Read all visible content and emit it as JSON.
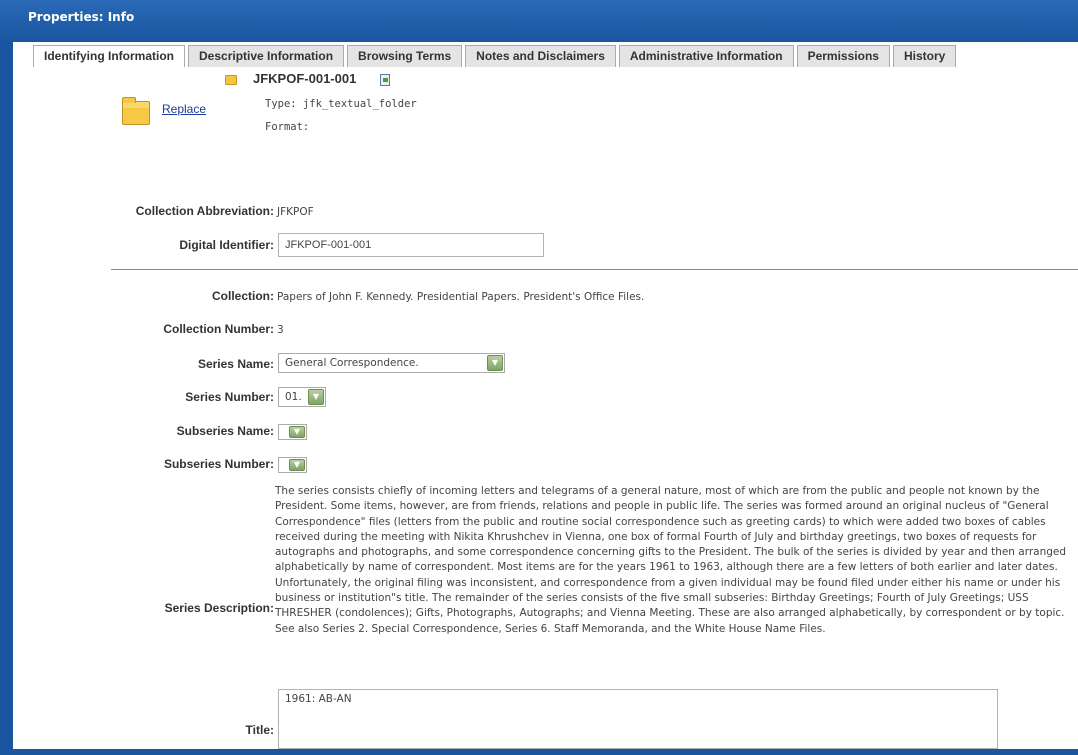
{
  "window": {
    "title": "Properties: Info"
  },
  "tabs": [
    {
      "label": "Identifying Information",
      "active": true
    },
    {
      "label": "Descriptive Information",
      "active": false
    },
    {
      "label": "Browsing Terms",
      "active": false
    },
    {
      "label": "Notes and Disclaimers",
      "active": false
    },
    {
      "label": "Administrative Information",
      "active": false
    },
    {
      "label": "Permissions",
      "active": false
    },
    {
      "label": "History",
      "active": false
    }
  ],
  "object": {
    "name": "JFKPOF-001-001",
    "type_text": "Type:  jfk_textual_folder",
    "format_text": "Format:",
    "replace_label": "Replace"
  },
  "fields": {
    "collection_abbreviation": {
      "label": "Collection Abbreviation:",
      "value": "JFKPOF"
    },
    "digital_identifier": {
      "label": "Digital Identifier:",
      "value": "JFKPOF-001-001"
    },
    "collection": {
      "label": "Collection:",
      "value": "Papers of John F. Kennedy. Presidential Papers. President's Office Files."
    },
    "collection_number": {
      "label": "Collection Number:",
      "value": "3"
    },
    "series_name": {
      "label": "Series Name:",
      "value": "General Correspondence."
    },
    "series_number": {
      "label": "Series Number:",
      "value": "01."
    },
    "subseries_name": {
      "label": "Subseries Name:",
      "value": ""
    },
    "subseries_number": {
      "label": "Subseries Number:",
      "value": ""
    },
    "series_description": {
      "label": "Series Description:",
      "value": "The series consists chiefly of incoming letters and telegrams of a general nature, most of which are from the public and people not known by the President. Some items, however, are from friends, relations and people in public life. The series was formed around an original nucleus of \"General Correspondence\" files (letters from the public and routine social correspondence such as greeting cards) to which were added two boxes of cables received during the meeting with Nikita Khrushchev in Vienna, one box of formal Fourth of July and birthday greetings, two boxes of requests for autographs and photographs, and some correspondence concerning gifts to the President. The bulk of the series is divided by year and then arranged alphabetically by name of correspondent. Most items are for the years 1961 to 1963, although there are a few letters of both earlier and later dates. Unfortunately, the original filing was inconsistent, and correspondence from a given individual may be found filed under either his name or under his business or institution\"s title. The remainder of the series consists of the five small subseries: Birthday Greetings; Fourth of July Greetings; USS THRESHER (condolences); Gifts, Photographs, Autographs; and Vienna Meeting. These are also arranged alphabetically, by correspondent or by topic. See also Series 2. Special Correspondence, Series 6. Staff Memoranda, and the White House Name Files."
    },
    "title": {
      "label": "Title:",
      "value": "1961: AB-AN"
    }
  },
  "icons": {
    "folder_small": "folder-icon",
    "folder_large": "folder-icon",
    "document": "document-icon",
    "dropdown": "chevron-down-icon"
  },
  "colors": {
    "titlebar": "#1e5ba8",
    "link": "#1a3c9c",
    "select_arrow": "#7fa465"
  }
}
